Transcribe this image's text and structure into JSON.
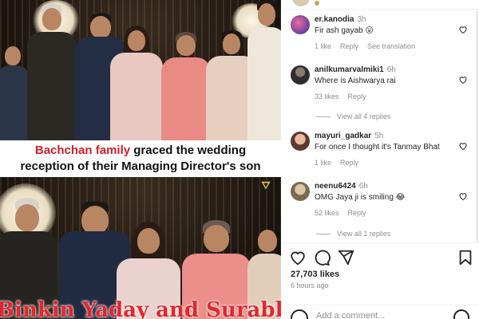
{
  "post": {
    "caption_highlight": "Bachchan family",
    "caption_rest_line1": " graced the wedding",
    "caption_line2": "reception of their Managing Director's son",
    "overlay_name": "Binkin Yaday and Surabhi"
  },
  "comments": [
    {
      "username": "er.kanodia",
      "time": "3h",
      "text": "Fir ash gayab 😮",
      "likes": "1 like",
      "reply": "Reply",
      "extra": "See translation",
      "avatar_color": "#6a3fa0"
    },
    {
      "username": "anilkumarvalmiki1",
      "time": "6h",
      "text": "Where is Aishwarya rai",
      "likes": "33 likes",
      "reply": "Reply",
      "extra": "",
      "avatar_color": "#3b3b3b",
      "view_replies": "View all 4 replies"
    },
    {
      "username": "mayuri_gadkar",
      "time": "5h",
      "text": "For once I thought it's Tanmay Bhat",
      "likes": "1 like",
      "reply": "Reply",
      "extra": "",
      "avatar_color": "#c98b7a"
    },
    {
      "username": "neenu6424",
      "time": "6h",
      "text": "OMG Jaya ji is smiling 😂",
      "likes": "52 likes",
      "reply": "Reply",
      "extra": "",
      "avatar_color": "#9c8c70",
      "view_replies": "View all 1 replies"
    }
  ],
  "actions": {
    "like_icon": "heart-icon",
    "comment_icon": "comment-icon",
    "share_icon": "share-icon",
    "save_icon": "bookmark-icon"
  },
  "stats": {
    "likes": "27,703 likes",
    "time_ago": "6 hours ago"
  },
  "add_comment": {
    "placeholder": "Add a comment..."
  },
  "colors": {
    "caption_red": "#d0202a",
    "overlay_red": "#e3262e",
    "meta_gray": "#8e8e8e",
    "text": "#262626"
  }
}
